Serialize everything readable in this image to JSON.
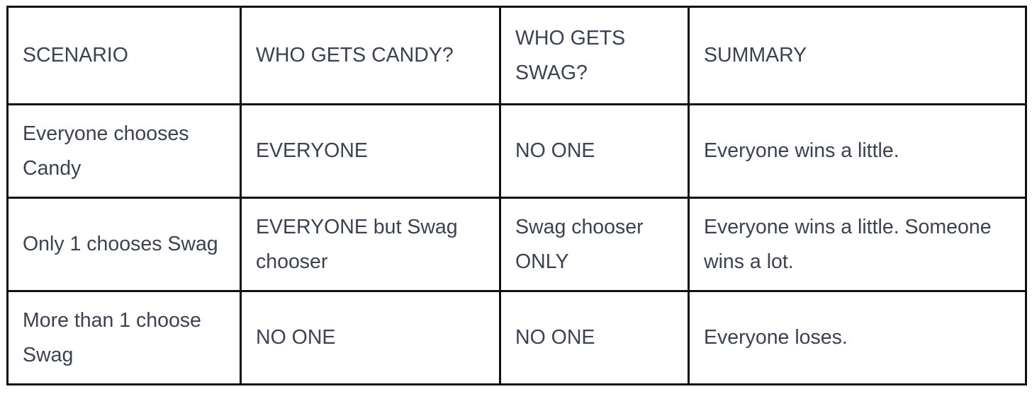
{
  "table": {
    "headers": [
      "SCENARIO",
      "WHO GETS CANDY?",
      "WHO GETS SWAG?",
      "SUMMARY"
    ],
    "rows": [
      [
        "Everyone chooses Candy",
        "EVERYONE",
        "NO ONE",
        "Everyone wins a little."
      ],
      [
        "Only 1 chooses Swag",
        "EVERYONE but Swag chooser",
        "Swag chooser ONLY",
        "Everyone wins a little. Someone wins a lot."
      ],
      [
        "More than 1 choose Swag",
        "NO ONE",
        "NO ONE",
        "Everyone loses."
      ]
    ]
  },
  "colors": {
    "text": "#3b4253",
    "border": "#111111",
    "background": "#ffffff"
  }
}
